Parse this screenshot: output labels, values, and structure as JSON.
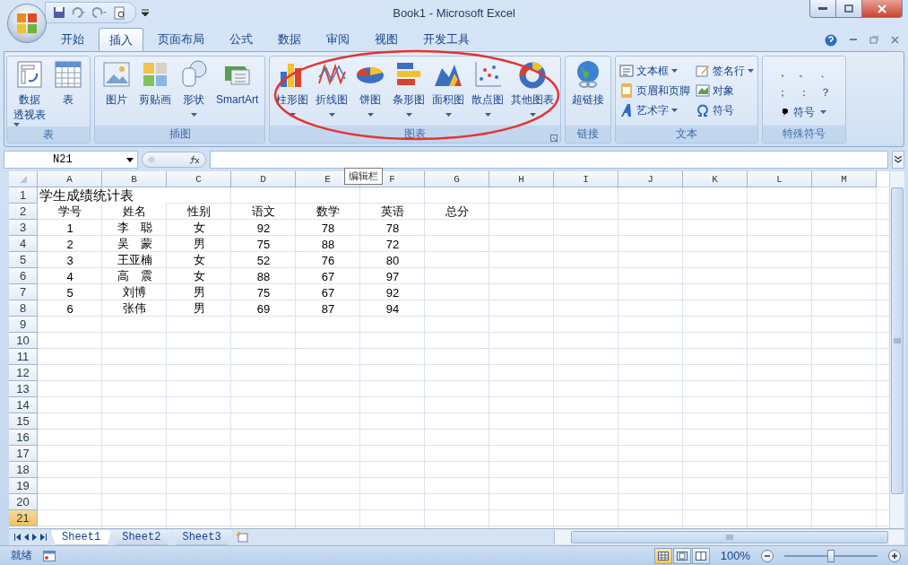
{
  "window": {
    "title": "Book1 - Microsoft Excel"
  },
  "tabs": [
    {
      "label": "开始",
      "selected": false
    },
    {
      "label": "插入",
      "selected": true
    },
    {
      "label": "页面布局",
      "selected": false
    },
    {
      "label": "公式",
      "selected": false
    },
    {
      "label": "数据",
      "selected": false
    },
    {
      "label": "审阅",
      "selected": false
    },
    {
      "label": "视图",
      "selected": false
    },
    {
      "label": "开发工具",
      "selected": false
    }
  ],
  "ribbon": {
    "groups": [
      {
        "label": "表",
        "launcher": false,
        "items": [
          {
            "kind": "large",
            "lines": [
              "数据",
              "透视表"
            ],
            "dropdown": true
          },
          {
            "kind": "large",
            "lines": [
              "表"
            ],
            "dropdown": false
          }
        ]
      },
      {
        "label": "插图",
        "launcher": false,
        "items": [
          {
            "kind": "large",
            "lines": [
              "图片"
            ],
            "dropdown": false
          },
          {
            "kind": "large",
            "lines": [
              "剪贴画"
            ],
            "dropdown": false
          },
          {
            "kind": "large",
            "lines": [
              "形状"
            ],
            "dropdown": true
          },
          {
            "kind": "large",
            "lines": [
              "SmartArt"
            ],
            "dropdown": false
          }
        ]
      },
      {
        "label": "图表",
        "launcher": true,
        "items": [
          {
            "kind": "large",
            "lines": [
              "柱形图"
            ],
            "dropdown": true
          },
          {
            "kind": "large",
            "lines": [
              "折线图"
            ],
            "dropdown": true
          },
          {
            "kind": "large",
            "lines": [
              "饼图"
            ],
            "dropdown": true
          },
          {
            "kind": "large",
            "lines": [
              "条形图"
            ],
            "dropdown": true
          },
          {
            "kind": "large",
            "lines": [
              "面积图"
            ],
            "dropdown": true
          },
          {
            "kind": "large",
            "lines": [
              "散点图"
            ],
            "dropdown": true
          },
          {
            "kind": "large",
            "lines": [
              "其他图表"
            ],
            "dropdown": true
          }
        ]
      },
      {
        "label": "链接",
        "launcher": false,
        "items": [
          {
            "kind": "large",
            "lines": [
              "超链接"
            ],
            "dropdown": false
          }
        ]
      },
      {
        "label": "文本",
        "launcher": false,
        "items": [
          {
            "kind": "small",
            "label": "文本框",
            "dropdown": true
          },
          {
            "kind": "small",
            "label": "页眉和页脚",
            "dropdown": false
          },
          {
            "kind": "small",
            "label": "艺术字",
            "dropdown": true
          },
          {
            "kind": "small",
            "label": "签名行",
            "dropdown": true
          },
          {
            "kind": "small",
            "label": "对象",
            "dropdown": false
          },
          {
            "kind": "small",
            "label": "符号",
            "dropdown": false
          }
        ]
      },
      {
        "label": "特殊符号",
        "launcher": false,
        "items": [
          {
            "kind": "symbol",
            "label": "，"
          },
          {
            "kind": "symbol",
            "label": "。"
          },
          {
            "kind": "symbol",
            "label": "、"
          },
          {
            "kind": "symbol",
            "label": "；"
          },
          {
            "kind": "symbol",
            "label": "："
          },
          {
            "kind": "symbol",
            "label": "？"
          },
          {
            "kind": "small",
            "label": "符号",
            "dropdown": true
          }
        ]
      }
    ]
  },
  "formula_bar": {
    "name_box": "N21",
    "tooltip": "编辑栏"
  },
  "sheet": {
    "columns": [
      "A",
      "B",
      "C",
      "D",
      "E",
      "F",
      "G",
      "H",
      "I",
      "J",
      "K",
      "L",
      "M"
    ],
    "rows": [
      {
        "header": "1",
        "selected": false,
        "kind": "title",
        "values": [
          "学生成绩统计表"
        ]
      },
      {
        "header": "2",
        "selected": false,
        "kind": "data",
        "values": [
          "学号",
          "姓名",
          "性别",
          "语文",
          "数学",
          "英语",
          "总分"
        ]
      },
      {
        "header": "3",
        "selected": false,
        "kind": "data",
        "values": [
          "1",
          "李　聪",
          "女",
          "92",
          "78",
          "78"
        ]
      },
      {
        "header": "4",
        "selected": false,
        "kind": "data",
        "values": [
          "2",
          "吴　蒙",
          "男",
          "75",
          "88",
          "72"
        ]
      },
      {
        "header": "5",
        "selected": false,
        "kind": "data",
        "values": [
          "3",
          "王亚楠",
          "女",
          "52",
          "76",
          "80"
        ]
      },
      {
        "header": "6",
        "selected": false,
        "kind": "data",
        "values": [
          "4",
          "高　震",
          "女",
          "88",
          "67",
          "97"
        ]
      },
      {
        "header": "7",
        "selected": false,
        "kind": "data",
        "values": [
          "5",
          "刘博",
          "男",
          "75",
          "67",
          "92"
        ]
      },
      {
        "header": "8",
        "selected": false,
        "kind": "data",
        "values": [
          "6",
          "张伟",
          "男",
          "69",
          "87",
          "94"
        ]
      },
      {
        "header": "9",
        "selected": false,
        "kind": "blank"
      },
      {
        "header": "10",
        "selected": false,
        "kind": "blank"
      },
      {
        "header": "11",
        "selected": false,
        "kind": "blank"
      },
      {
        "header": "12",
        "selected": false,
        "kind": "blank"
      },
      {
        "header": "13",
        "selected": false,
        "kind": "blank"
      },
      {
        "header": "14",
        "selected": false,
        "kind": "blank"
      },
      {
        "header": "15",
        "selected": false,
        "kind": "blank"
      },
      {
        "header": "16",
        "selected": false,
        "kind": "blank"
      },
      {
        "header": "17",
        "selected": false,
        "kind": "blank"
      },
      {
        "header": "18",
        "selected": false,
        "kind": "blank"
      },
      {
        "header": "19",
        "selected": false,
        "kind": "blank"
      },
      {
        "header": "20",
        "selected": false,
        "kind": "blank"
      },
      {
        "header": "21",
        "selected": true,
        "kind": "blank"
      }
    ]
  },
  "sheet_tabs": [
    {
      "label": "Sheet1",
      "selected": true
    },
    {
      "label": "Sheet2",
      "selected": false
    },
    {
      "label": "Sheet3",
      "selected": false
    }
  ],
  "status_bar": {
    "status": "就绪",
    "views": [
      {
        "selected": true
      },
      {
        "selected": false
      },
      {
        "selected": false
      }
    ],
    "zoom": "100%",
    "zoom_slider": {
      "level": 0.5
    }
  }
}
